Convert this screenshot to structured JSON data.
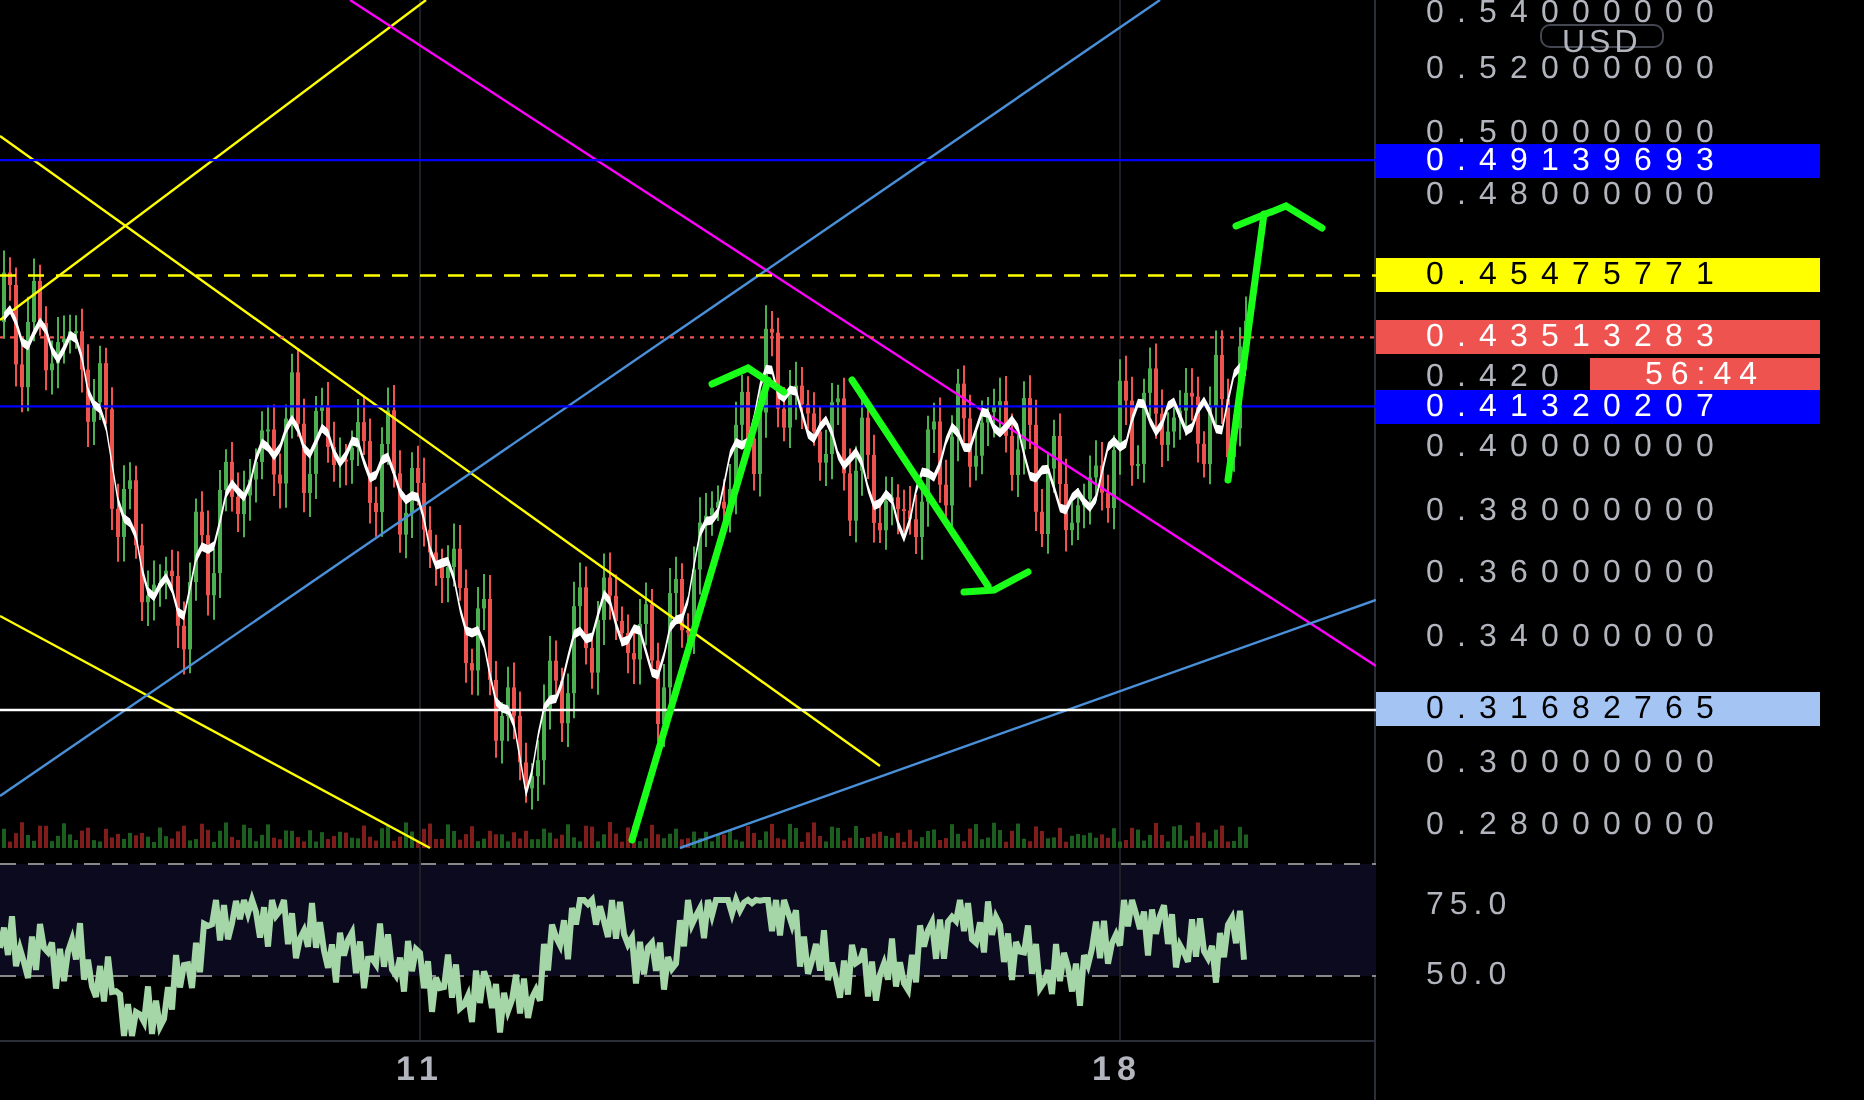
{
  "price_axis": {
    "currency_button": "USD",
    "labels": [
      "0.54000000",
      "0.52000000",
      "0.50000000",
      "0.48000000",
      "0.420",
      "0.40000000",
      "0.38000000",
      "0.36000000",
      "0.34000000",
      "0.30000000",
      "0.28000000"
    ]
  },
  "price_tags": [
    {
      "value": "0.49139693",
      "color": "#0000ff",
      "kind": "solid"
    },
    {
      "value": "0.45475771",
      "color": "#ffff00",
      "kind": "dashed"
    },
    {
      "value": "0.43513283",
      "color": "#ef5350",
      "kind": "dotted"
    },
    {
      "value": "0.41320207",
      "color": "#0000ff",
      "kind": "solid"
    },
    {
      "value": "0.31682765",
      "color": "#a4c4f4",
      "kind": "solid"
    }
  ],
  "countdown": "56:44",
  "rsi_axis": {
    "labels": [
      "75.0",
      "50.0"
    ]
  },
  "time_axis": {
    "labels": [
      "11",
      "18"
    ]
  }
}
